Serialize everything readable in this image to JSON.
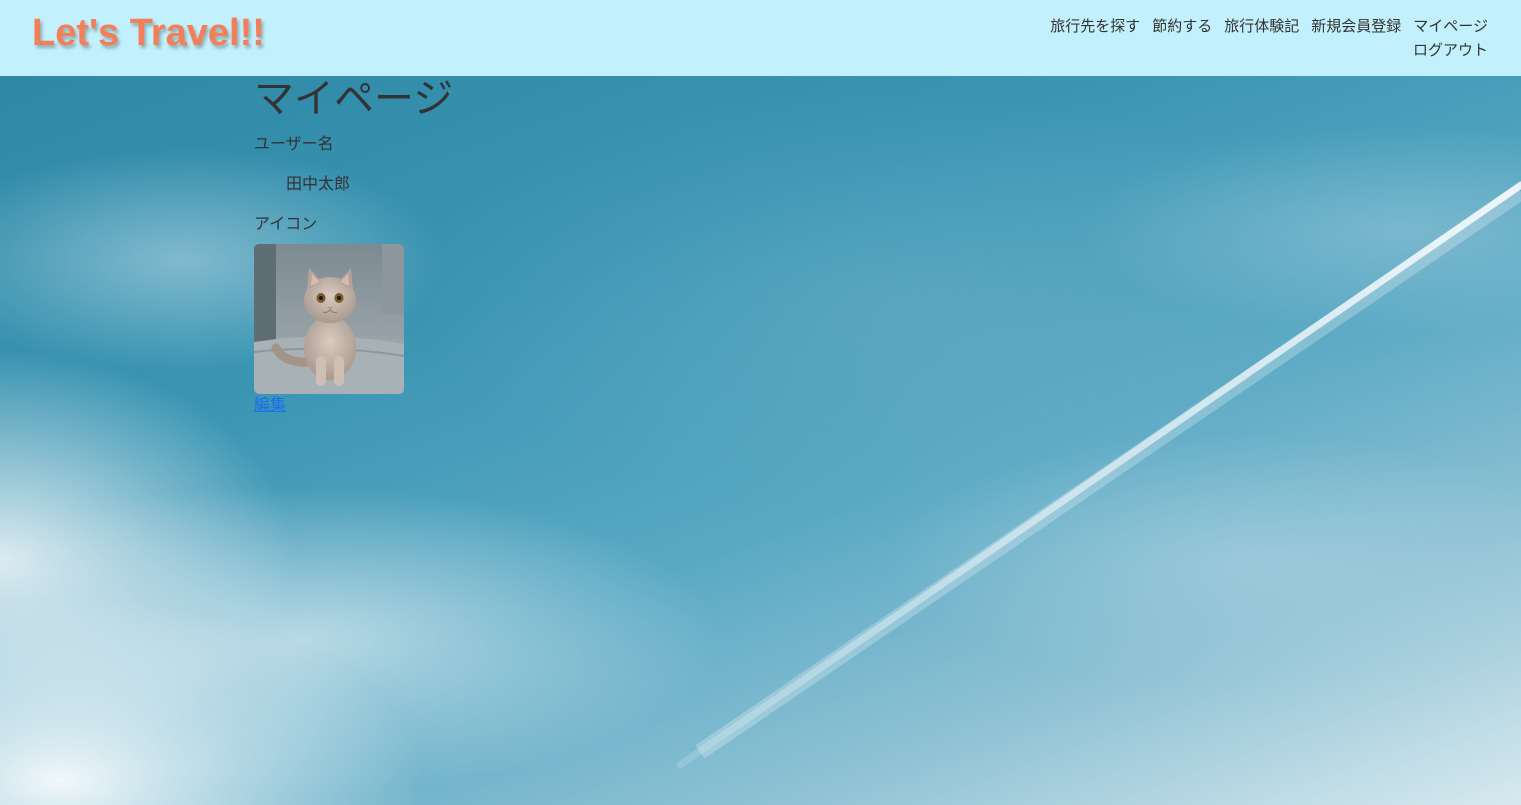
{
  "header": {
    "logo_text": "Let's Travel!!",
    "nav": [
      {
        "label": "旅行先を探す"
      },
      {
        "label": "節約する"
      },
      {
        "label": "旅行体験記"
      },
      {
        "label": "新規会員登録"
      },
      {
        "label": "マイページ"
      },
      {
        "label": "ログアウト"
      }
    ]
  },
  "main": {
    "title": "マイページ",
    "username_label": "ユーザー名",
    "username_value": "田中太郎",
    "icon_label": "アイコン",
    "avatar": "cat-photo",
    "edit_link": "編集"
  },
  "colors": {
    "header_bg": "#c2f0fc",
    "logo": "#f47e57",
    "link": "#1a6fe8",
    "text": "#333333"
  }
}
